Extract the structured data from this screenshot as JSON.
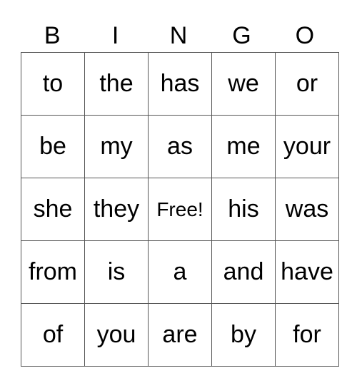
{
  "header": [
    "B",
    "I",
    "N",
    "G",
    "O"
  ],
  "rows": [
    [
      "to",
      "the",
      "has",
      "we",
      "or"
    ],
    [
      "be",
      "my",
      "as",
      "me",
      "your"
    ],
    [
      "she",
      "they",
      "Free!",
      "his",
      "was"
    ],
    [
      "from",
      "is",
      "a",
      "and",
      "have"
    ],
    [
      "of",
      "you",
      "are",
      "by",
      "for"
    ]
  ]
}
